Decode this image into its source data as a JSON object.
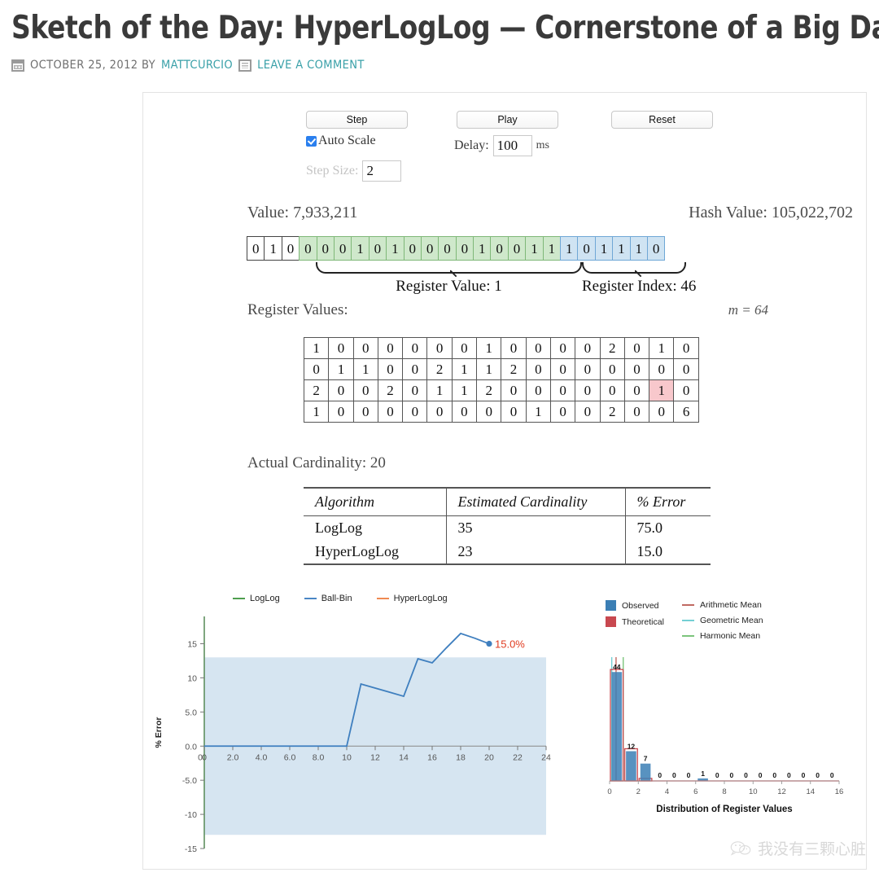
{
  "post": {
    "title": "Sketch of the Day: HyperLogLog — Cornerstone of a Big Data Infrastructure",
    "date": "OCTOBER 25, 2012 BY",
    "author": "MATTCURCIO",
    "comment_link": "LEAVE A COMMENT"
  },
  "controls": {
    "step_button": "Step",
    "play_button": "Play",
    "reset_button": "Reset",
    "auto_scale_label": "Auto Scale",
    "auto_scale_checked": true,
    "step_size_label": "Step Size:",
    "step_size_value": "2",
    "delay_label": "Delay:",
    "delay_value": "100",
    "delay_unit": "ms"
  },
  "readout": {
    "value_label": "Value: 7,933,211",
    "hash_label": "Hash Value: 105,022,702",
    "register_value_brace": "Register Value: 1",
    "register_index_brace": "Register Index: 46"
  },
  "bits": {
    "white": [
      "0",
      "1",
      "0"
    ],
    "green": [
      "0",
      "0",
      "0",
      "1",
      "0",
      "1",
      "0",
      "0",
      "0",
      "0",
      "1",
      "0",
      "0",
      "1",
      "1"
    ],
    "blue": [
      "1",
      "0",
      "1",
      "1",
      "1",
      "0"
    ],
    "colors": {
      "green": "#cfe8cb",
      "blue": "#cfe3f2"
    }
  },
  "registers": {
    "heading": "Register Values:",
    "m_label": "m = 64",
    "rows": [
      [
        "1",
        "0",
        "0",
        "0",
        "0",
        "0",
        "0",
        "1",
        "0",
        "0",
        "0",
        "0",
        "2",
        "0",
        "1",
        "0"
      ],
      [
        "0",
        "1",
        "1",
        "0",
        "0",
        "2",
        "1",
        "1",
        "2",
        "0",
        "0",
        "0",
        "0",
        "0",
        "0",
        "0"
      ],
      [
        "2",
        "0",
        "0",
        "2",
        "0",
        "1",
        "1",
        "2",
        "0",
        "0",
        "0",
        "0",
        "0",
        "0",
        "1",
        "0"
      ],
      [
        "1",
        "0",
        "0",
        "0",
        "0",
        "0",
        "0",
        "0",
        "0",
        "1",
        "0",
        "0",
        "2",
        "0",
        "0",
        "6"
      ]
    ],
    "highlight": {
      "row": 2,
      "col": 14,
      "color": "#f8c8cc"
    }
  },
  "cardinality": {
    "actual_label": "Actual Cardinality: 20",
    "headers": [
      "Algorithm",
      "Estimated Cardinality",
      "% Error"
    ],
    "rows": [
      {
        "algorithm": "LogLog",
        "estimate": "35",
        "error": "75.0"
      },
      {
        "algorithm": "HyperLogLog",
        "estimate": "23",
        "error": "15.0"
      }
    ]
  },
  "chart_data": [
    {
      "type": "line",
      "title": "",
      "xlabel": "",
      "ylabel": "% Error",
      "xlim": [
        0,
        24
      ],
      "ylim": [
        -15,
        19
      ],
      "xticks": [
        "0",
        "0",
        "2.0",
        "4.0",
        "6.0",
        "8.0",
        "10",
        "12",
        "14",
        "16",
        "18",
        "20",
        "22",
        "24"
      ],
      "yticks": [
        "15",
        "10",
        "5.0",
        "0.0",
        "-5.0",
        "-10",
        "-15"
      ],
      "legend": [
        {
          "name": "LogLog",
          "color": "#4e9e4e"
        },
        {
          "name": "Ball-Bin",
          "color": "#4a86c5"
        },
        {
          "name": "HyperLogLog",
          "color": "#f08a52"
        }
      ],
      "shaded_band": {
        "from": -13,
        "to": 13,
        "color": "#d6e5f1"
      },
      "annotation": "15.0%",
      "annotation_color": "#e03b20",
      "series": [
        {
          "name": "HyperLogLog % Error",
          "color": "#3f7fbf",
          "x": [
            0,
            1,
            2,
            3,
            4,
            5,
            6,
            7,
            8,
            9,
            10,
            11,
            12,
            13,
            14,
            15,
            16,
            17,
            18,
            19,
            20
          ],
          "values": [
            0,
            0,
            0,
            0,
            0,
            0,
            0,
            0,
            0,
            0,
            0,
            9.1,
            8.5,
            7.9,
            7.3,
            12.8,
            12.2,
            14.4,
            16.5,
            15.8,
            15.0
          ]
        }
      ]
    },
    {
      "type": "bar",
      "title": "",
      "xlabel": "Distribution of Register Values",
      "ylabel": "",
      "xlim": [
        0,
        16
      ],
      "ylim": [
        0,
        50
      ],
      "xticks": [
        "0",
        "2",
        "4",
        "6",
        "8",
        "10",
        "12",
        "14",
        "16"
      ],
      "categories": [
        "0",
        "1",
        "2",
        "3",
        "4",
        "5",
        "6",
        "7",
        "8",
        "9",
        "10",
        "11",
        "12",
        "13",
        "14",
        "15"
      ],
      "bar_labels": [
        "44",
        "12",
        "7",
        "0",
        "0",
        "0",
        "1",
        "0",
        "0",
        "0",
        "0",
        "0",
        "0",
        "0",
        "0",
        "0"
      ],
      "legend": [
        {
          "name": "Observed",
          "type": "swatch",
          "color": "#3b7fb5"
        },
        {
          "name": "Theoretical",
          "type": "swatch",
          "color": "#c8484f"
        },
        {
          "name": "Arithmetic Mean",
          "type": "line",
          "color": "#c06a62"
        },
        {
          "name": "Geometric Mean",
          "type": "line",
          "color": "#74cfd4"
        },
        {
          "name": "Harmonic Mean",
          "type": "line",
          "color": "#7dc57d"
        }
      ],
      "series": [
        {
          "name": "Observed",
          "color": "#3b7fb5",
          "values": [
            44,
            12,
            7,
            0,
            0,
            0,
            1,
            0,
            0,
            0,
            0,
            0,
            0,
            0,
            0,
            0
          ]
        },
        {
          "name": "Theoretical",
          "color": "#c8484f",
          "values": [
            45,
            13,
            1,
            0,
            0,
            0,
            0,
            0,
            0,
            0,
            0,
            0,
            0,
            0,
            0,
            0
          ]
        }
      ],
      "mean_lines": [
        {
          "name": "Geometric Mean",
          "color": "#74cfd4",
          "x": 0.15
        },
        {
          "name": "Arithmetic Mean",
          "color": "#c06a62",
          "x": 0.45
        },
        {
          "name": "Harmonic Mean",
          "color": "#7dc57d",
          "x": 0.95
        }
      ]
    }
  ],
  "watermark": {
    "text": "我没有三颗心脏"
  }
}
